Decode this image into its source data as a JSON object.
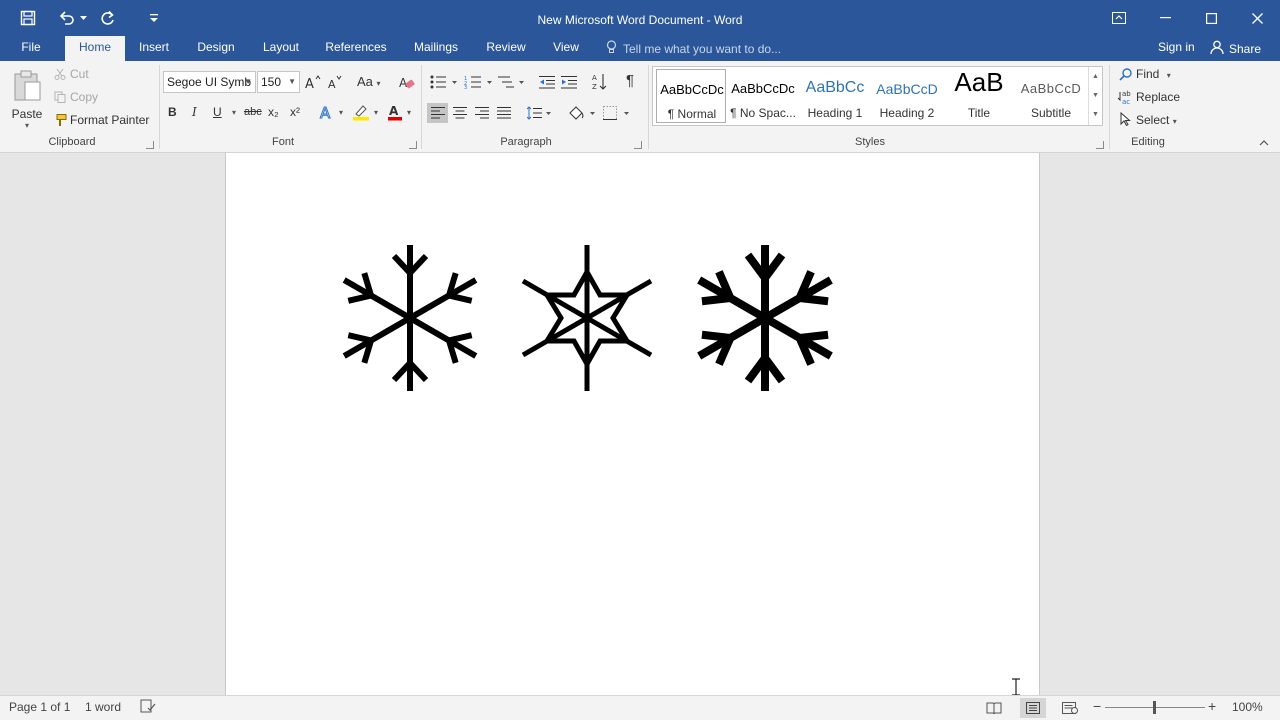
{
  "titlebar": {
    "title": "New Microsoft Word Document - Word",
    "qat_icons": [
      "save-icon",
      "undo-icon",
      "redo-icon",
      "customize-qat-icon"
    ],
    "window_icons": [
      "ribbon-display-options-icon",
      "minimize-icon",
      "maximize-icon",
      "close-icon"
    ]
  },
  "tabs": {
    "file": "File",
    "home": "Home",
    "insert": "Insert",
    "design": "Design",
    "layout": "Layout",
    "references": "References",
    "mailings": "Mailings",
    "review": "Review",
    "view": "View",
    "tell_me": "Tell me what you want to do...",
    "sign_in": "Sign in",
    "share": "Share"
  },
  "clipboard": {
    "paste": "Paste",
    "cut": "Cut",
    "copy": "Copy",
    "format_painter": "Format Painter",
    "label": "Clipboard"
  },
  "font": {
    "family": "Segoe UI Symb",
    "size": "150",
    "change_case": "Aa",
    "bold": "B",
    "italic": "I",
    "underline": "U",
    "strike": "abc",
    "subscript": "x₂",
    "superscript": "x²",
    "label": "Font",
    "highlight_color": "#ffe800",
    "font_color": "#e00000"
  },
  "paragraph": {
    "label": "Paragraph",
    "pilcrow": "¶"
  },
  "styles": {
    "label": "Styles",
    "items": [
      {
        "sample": "AaBbCcDc",
        "name": "¶ Normal"
      },
      {
        "sample": "AaBbCcDc",
        "name": "¶ No Spac..."
      },
      {
        "sample": "AaBbCc",
        "name": "Heading 1"
      },
      {
        "sample": "AaBbCcD",
        "name": "Heading 2"
      },
      {
        "sample": "AaB",
        "name": "Title"
      },
      {
        "sample": "AaBbCcD",
        "name": "Subtitle"
      }
    ]
  },
  "editing": {
    "find": "Find",
    "replace": "Replace",
    "select": "Select",
    "label": "Editing"
  },
  "document": {
    "content_glyphs": [
      "snowflake",
      "snowflake-outline",
      "heavy-snowflake"
    ]
  },
  "status": {
    "page": "Page 1 of 1",
    "words": "1 word",
    "zoom": "100%",
    "zoom_level": 1.0
  },
  "colors": {
    "accent": "#2b579a",
    "ribbon_bg": "#f3f3f3",
    "workspace_bg": "#e6e6e6"
  }
}
